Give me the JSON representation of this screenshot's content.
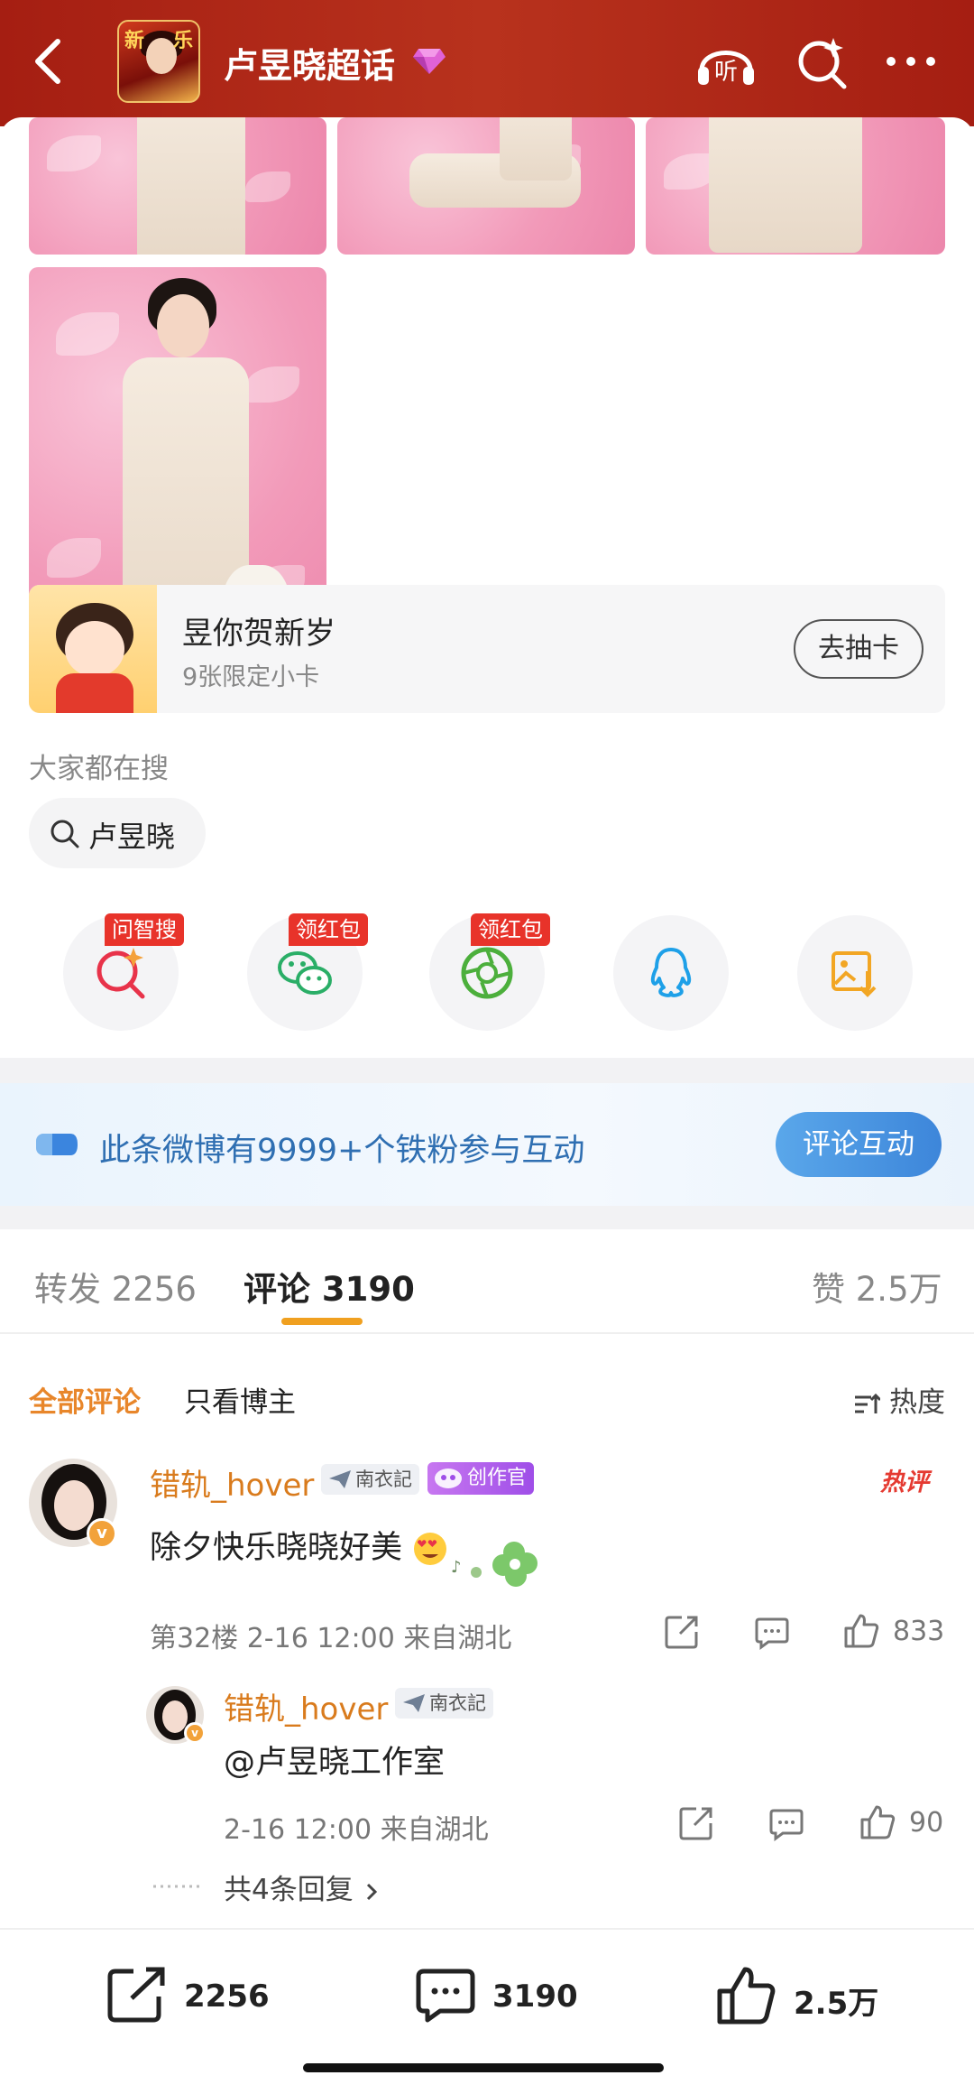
{
  "header": {
    "title": "卢昱晓超话",
    "avatar_text": [
      "新",
      "乐"
    ],
    "icons": [
      "back-icon",
      "gem-icon",
      "listen-icon",
      "search-star-icon",
      "more-icon"
    ],
    "listen_label": "听",
    "accent_color": "#a51e12"
  },
  "card": {
    "title": "昱你贺新岁",
    "subtitle": "9张限定小卡",
    "button": "去抽卡"
  },
  "search": {
    "label": "大家都在搜",
    "chip": "卢昱晓"
  },
  "share": {
    "items": [
      {
        "icon": "ai-search-icon",
        "badge": "问智搜"
      },
      {
        "icon": "wechat-icon",
        "badge": "领红包"
      },
      {
        "icon": "moments-icon",
        "badge": "领红包"
      },
      {
        "icon": "qq-icon",
        "badge": ""
      },
      {
        "icon": "save-image-icon",
        "badge": ""
      }
    ]
  },
  "banner": {
    "text": "此条微博有9999+个铁粉参与互动",
    "button": "评论互动",
    "color": "#2f6fb2"
  },
  "tabs": {
    "repost": "转发 2256",
    "comment": "评论 3190",
    "like": "赞 2.5万"
  },
  "filters": {
    "all": "全部评论",
    "owner_only": "只看博主",
    "sort": "热度"
  },
  "comment": {
    "username": "错轨_hover",
    "tag": "南衣記",
    "creator_badge": "创作官",
    "hot": "热评",
    "text": "除夕快乐晓晓好美",
    "meta": "第32楼  2-16 12:00  来自湖北",
    "likes": "833"
  },
  "reply": {
    "username": "错轨_hover",
    "tag": "南衣記",
    "text": "@卢昱晓工作室",
    "meta": "2-16 12:00  来自湖北",
    "likes": "90",
    "more": "共4条回复"
  },
  "bottom_bar": {
    "reposts": "2256",
    "comments": "3190",
    "likes": "2.5万"
  }
}
